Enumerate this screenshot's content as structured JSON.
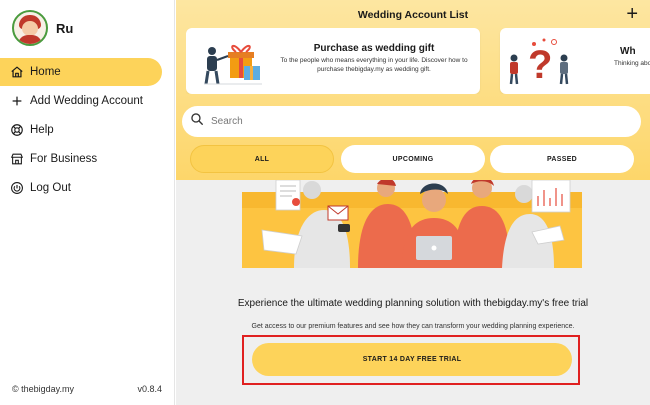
{
  "profile": {
    "name": "Ru"
  },
  "sidebar": {
    "items": [
      {
        "label": "Home",
        "icon": "home-icon",
        "active": true
      },
      {
        "label": "Add Wedding Account",
        "icon": "plus-icon"
      },
      {
        "label": "Help",
        "icon": "lifebuoy-icon"
      },
      {
        "label": "For Business",
        "icon": "store-icon"
      },
      {
        "label": "Log Out",
        "icon": "power-icon"
      }
    ],
    "footer": {
      "copyright": "© thebigday.my",
      "version": "v0.8.4"
    }
  },
  "header": {
    "title": "Wedding Account List",
    "add_icon": "plus-icon"
  },
  "cards": [
    {
      "title": "Purchase as wedding gift",
      "desc": "To the people who means everything in your life. Discover how to purchase thebigday.my as wedding gift."
    },
    {
      "title": "Wh",
      "desc": "Thinking about goin"
    }
  ],
  "search": {
    "placeholder": "Search",
    "icon": "search-icon"
  },
  "tabs": [
    {
      "label": "ALL",
      "active": true
    },
    {
      "label": "UPCOMING"
    },
    {
      "label": "PASSED"
    }
  ],
  "promo": {
    "headline": "Experience the ultimate wedding planning solution with thebigday.my's free trial",
    "subline": "Get access to our premium features and see how they can transform your wedding planning experience.",
    "cta_label": "START 14 DAY FREE TRIAL"
  },
  "colors": {
    "accent": "#fdd35a",
    "highlight": "#e02020",
    "avatar_ring": "#4a9b3e"
  }
}
